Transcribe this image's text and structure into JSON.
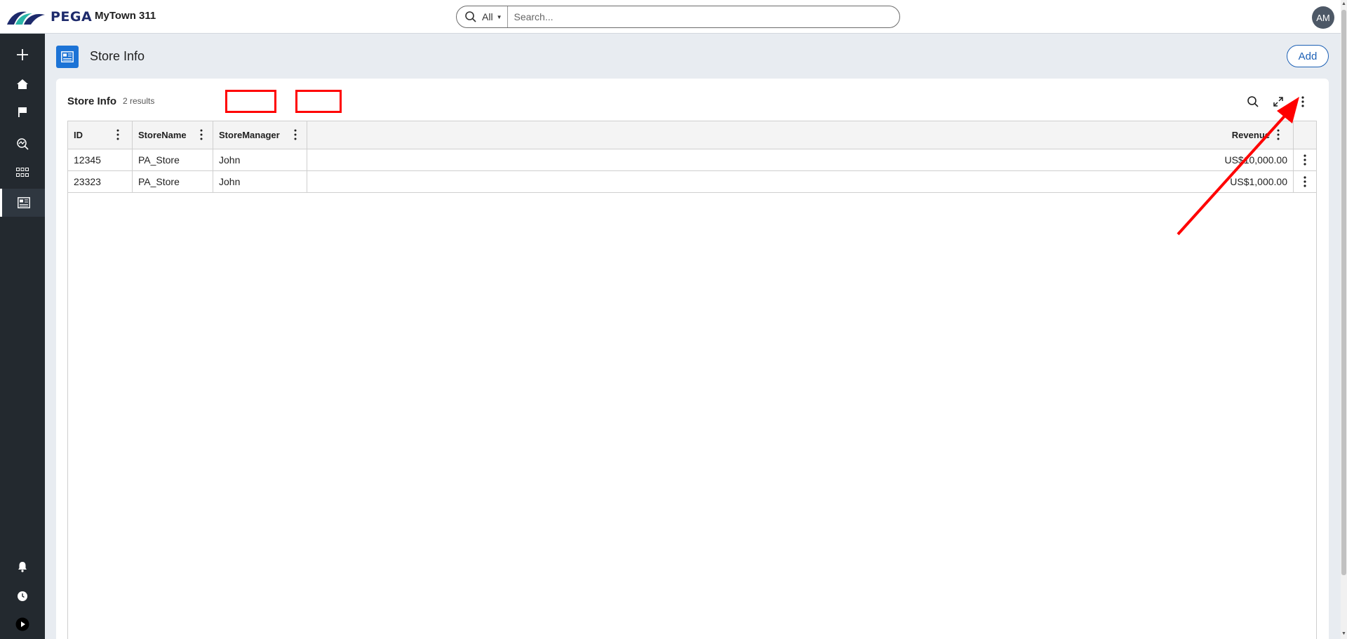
{
  "header": {
    "brand": "PEGA",
    "app_name": "MyTown 311",
    "search_scope": "All",
    "search_placeholder": "Search...",
    "avatar_initials": "AM"
  },
  "sidebar": {
    "items": [
      {
        "name": "create-icon",
        "active": false
      },
      {
        "name": "home-icon",
        "active": false
      },
      {
        "name": "flag-icon",
        "active": false
      },
      {
        "name": "explore-data-icon",
        "active": false
      },
      {
        "name": "apps-grid-icon",
        "active": false
      },
      {
        "name": "store-info-icon",
        "active": true
      }
    ],
    "bottom_items": [
      "notifications-icon",
      "recents-icon",
      "play-icon"
    ]
  },
  "page": {
    "title": "Store Info",
    "add_label": "Add"
  },
  "card": {
    "title": "Store Info",
    "result_count": "2 results"
  },
  "table": {
    "columns": [
      "ID",
      "StoreName",
      "StoreManager",
      "Revenue"
    ],
    "rows": [
      {
        "id": "12345",
        "store_name": "PA_Store",
        "store_manager": "John",
        "revenue": "US$10,000.00"
      },
      {
        "id": "23323",
        "store_name": "PA_Store",
        "store_manager": "John",
        "revenue": "US$1,000.00"
      }
    ]
  },
  "colors": {
    "sidebar": "#23292f",
    "accent": "#1c73d6",
    "annotation": "#ff0000"
  }
}
